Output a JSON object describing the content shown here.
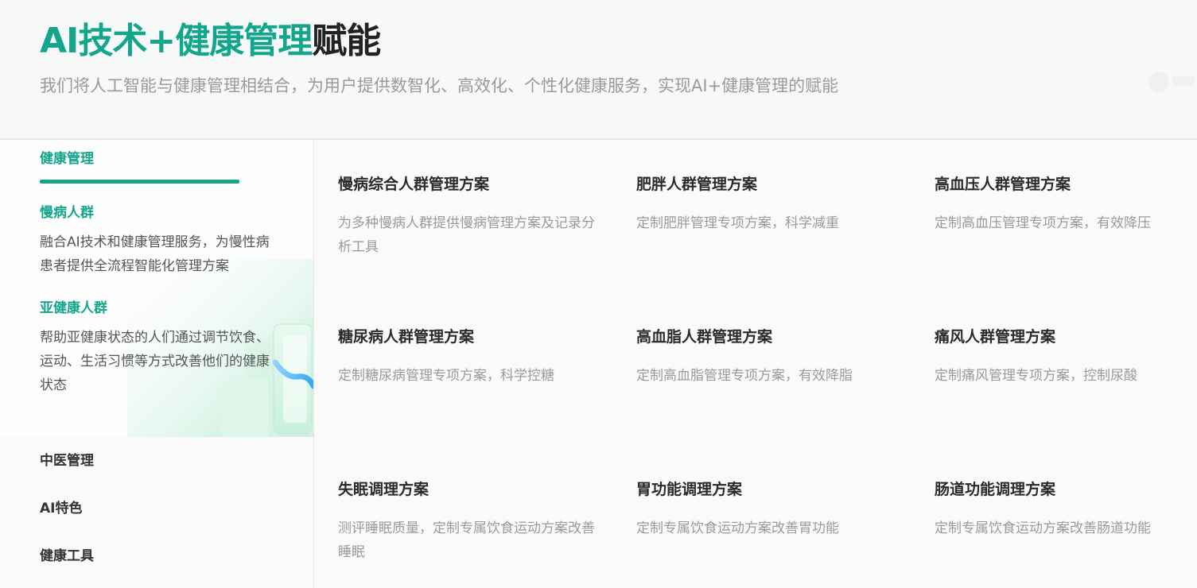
{
  "header": {
    "title_accent": "AI技术+健康管理",
    "title_rest": "赋能",
    "subtitle": "我们将人工智能与健康管理相结合，为用户提供数智化、高效化、个性化健康服务，实现AI+健康管理的赋能"
  },
  "sidebar": {
    "active_tab": "健康管理",
    "groups": [
      {
        "title": "慢病人群",
        "desc": "融合AI技术和健康管理服务，为慢性病患者提供全流程智能化管理方案"
      },
      {
        "title": "亚健康人群",
        "desc": "帮助亚健康状态的人们通过调节饮食、运动、生活习惯等方式改善他们的健康状态"
      }
    ],
    "items": [
      "中医管理",
      "AI特色",
      "健康工具"
    ]
  },
  "cards": [
    {
      "title": "慢病综合人群管理方案",
      "desc": "为多种慢病人群提供慢病管理方案及记录分析工具"
    },
    {
      "title": "肥胖人群管理方案",
      "desc": "定制肥胖管理专项方案，科学减重"
    },
    {
      "title": "高血压人群管理方案",
      "desc": "定制高血压管理专项方案，有效降压"
    },
    {
      "title": "糖尿病人群管理方案",
      "desc": "定制糖尿病管理专项方案，科学控糖"
    },
    {
      "title": "高血脂人群管理方案",
      "desc": "定制高血脂管理专项方案，有效降脂"
    },
    {
      "title": "痛风人群管理方案",
      "desc": "定制痛风管理专项方案，控制尿酸"
    },
    {
      "title": "失眠调理方案",
      "desc": "测评睡眠质量，定制专属饮食运动方案改善睡眠"
    },
    {
      "title": "胃功能调理方案",
      "desc": "定制专属饮食运动方案改善胃功能"
    },
    {
      "title": "肠道功能调理方案",
      "desc": "定制专属饮食运动方案改善肠道功能"
    }
  ],
  "colors": {
    "accent": "#14a68c",
    "text_dark": "#222222",
    "text_muted": "#9a9a9a"
  }
}
